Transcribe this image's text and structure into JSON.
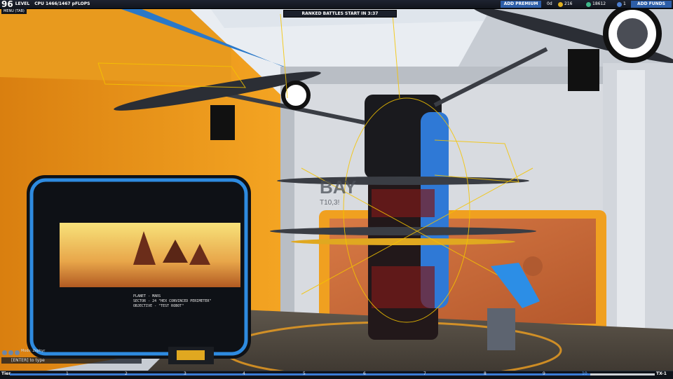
{
  "hud": {
    "level_number": "96",
    "level_label": "LEVEL",
    "cpu_text": "CPU 1466/1467 pFLOPS",
    "menu_label": "MENU (TAB)",
    "ranked_text": "RANKED BATTLES START IN 3:37",
    "add_premium_label": "ADD PREMIUM",
    "premium_days": "0d",
    "robits": "216",
    "tech_points": "18612",
    "cosmetic_credits": "1",
    "add_funds_label": "ADD FUNDS"
  },
  "scene": {
    "bay_label": "BAY",
    "bay_tier": "T10,3!",
    "screen_lines": [
      "PLANET - MARS",
      "SECTOR - 24 \"HEX CONVINCED PERIMETER\"",
      "OBJECTIVE - \"TEST ROBOT\""
    ]
  },
  "chat": {
    "notice": "Mods: Zephyr",
    "input_placeholder": "[ENTER] to type"
  },
  "tier_bar": {
    "start_label": "Tier",
    "end_label": "TX-1",
    "ticks": [
      "1",
      "2",
      "3",
      "4",
      "5",
      "6",
      "7",
      "8",
      "9",
      "10"
    ],
    "progress": 0.9
  },
  "colors": {
    "accent_blue": "#2d5ea8",
    "wall_orange": "#f0a020",
    "hologram": "#f5c400"
  }
}
